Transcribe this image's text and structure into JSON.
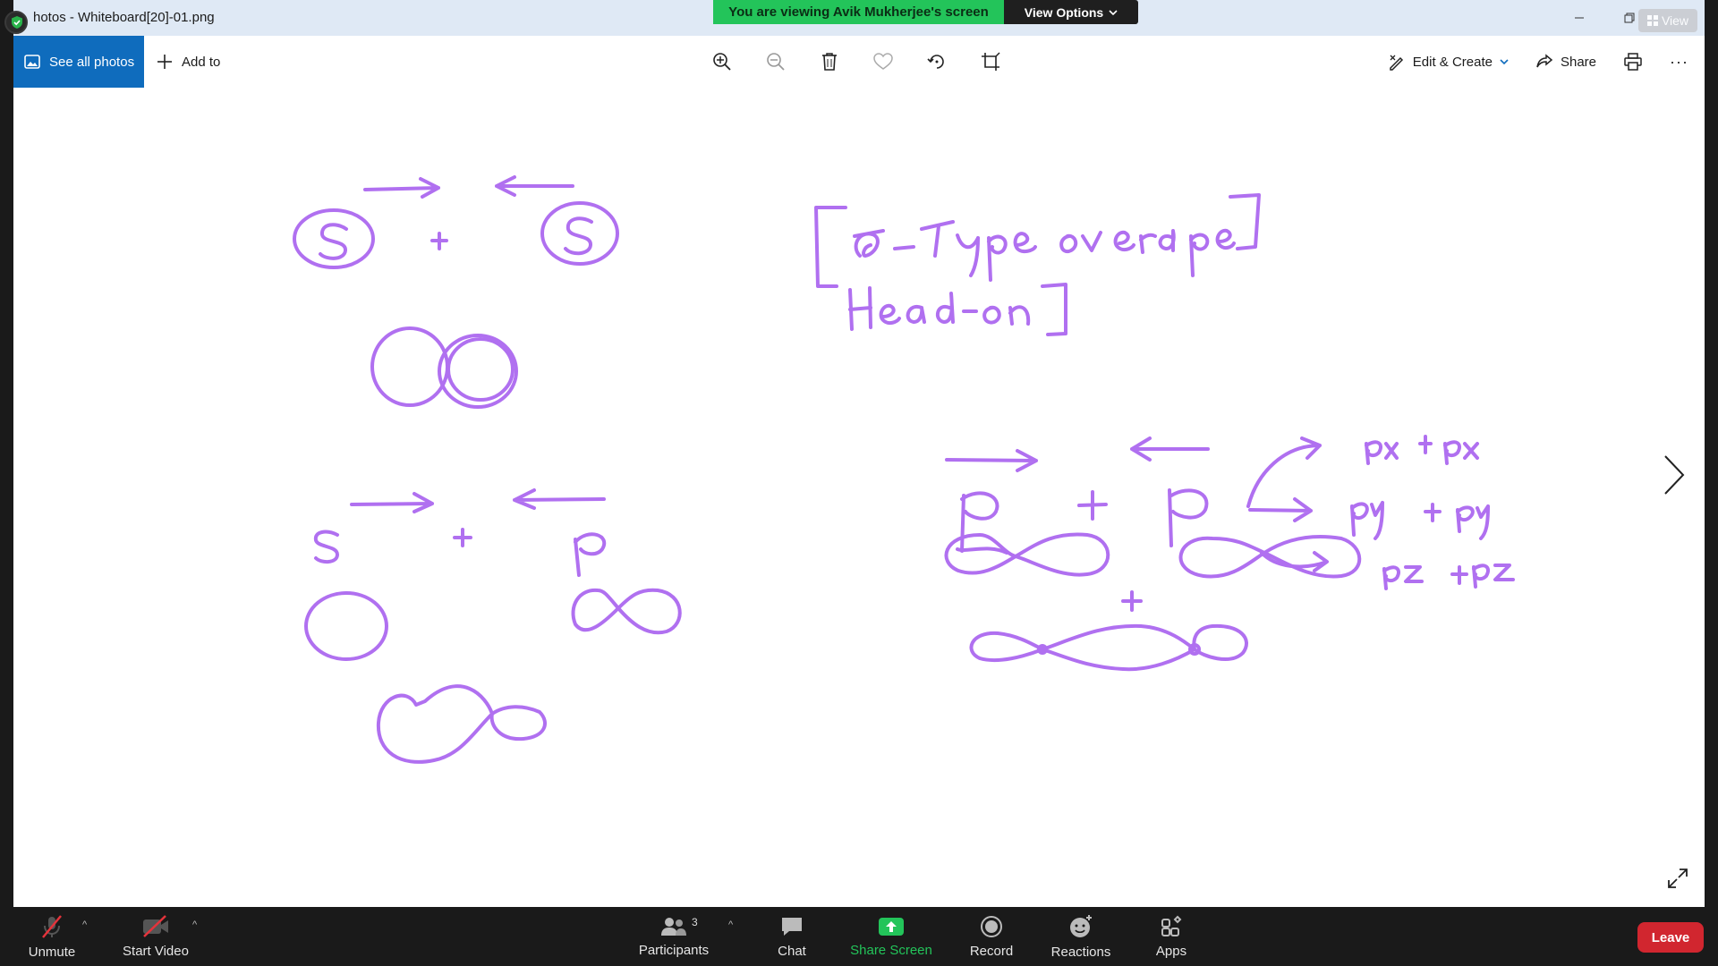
{
  "window": {
    "title": "hotos - Whiteboard[20]-01.png",
    "view_chip_label": "View"
  },
  "share_banner": {
    "message": "You are viewing Avik Mukherjee's screen",
    "view_options_label": "View Options"
  },
  "toolbar": {
    "see_all_photos": "See all photos",
    "add_to": "Add to",
    "edit_create": "Edit & Create",
    "share": "Share",
    "more": "···"
  },
  "whiteboard": {
    "stroke_color": "#b070f0",
    "handwriting": [
      "S",
      "+",
      "S",
      "[σ-Type overlap]",
      "Head-on",
      "s",
      "+",
      "p",
      "p",
      "+",
      "p",
      "px + px",
      "py + py",
      "pz + pz",
      "+"
    ]
  },
  "zoom_bar": {
    "unmute": "Unmute",
    "start_video": "Start Video",
    "participants": "Participants",
    "participants_count": "3",
    "chat": "Chat",
    "share_screen": "Share Screen",
    "record": "Record",
    "reactions": "Reactions",
    "apps": "Apps",
    "leave": "Leave"
  },
  "colors": {
    "zoom_green": "#23c45a",
    "photos_blue": "#0f6cbd",
    "leave_red": "#d1262f"
  }
}
